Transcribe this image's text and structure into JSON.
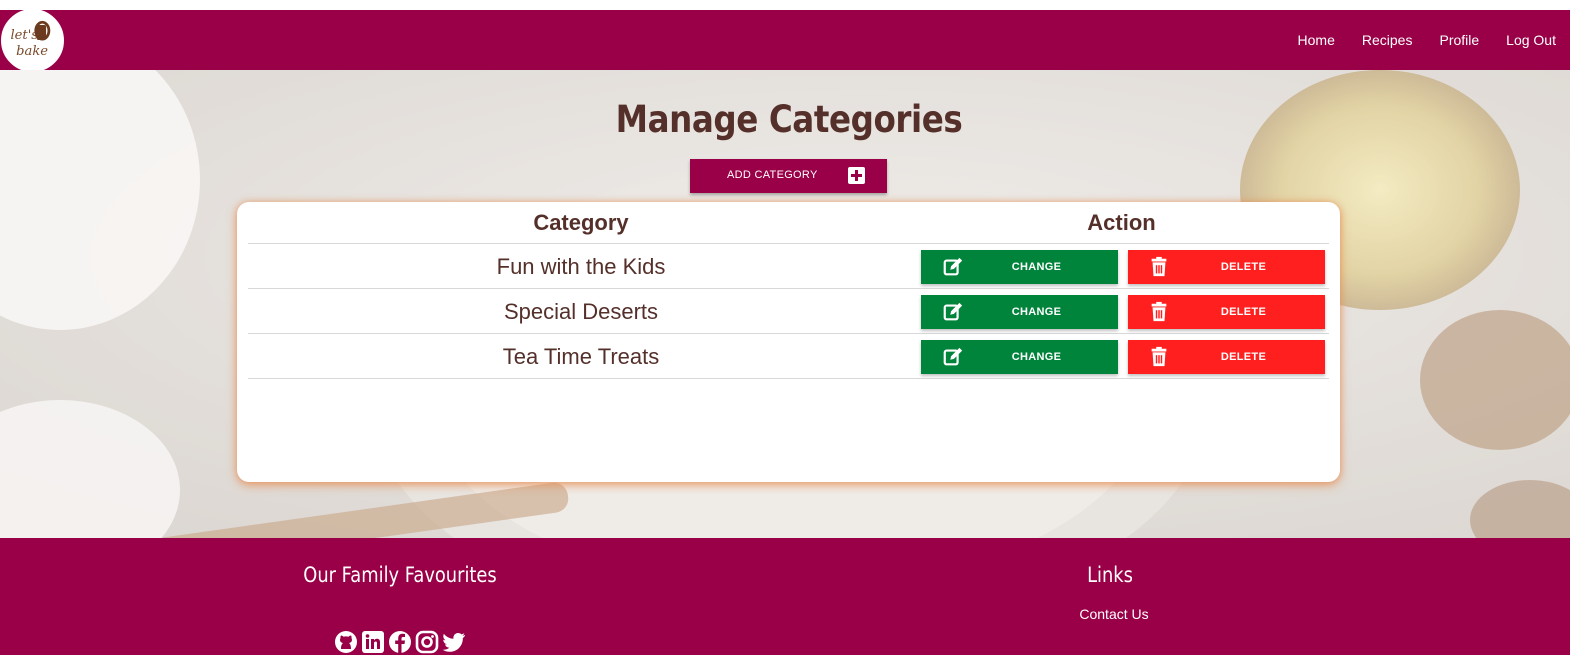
{
  "nav": {
    "logo_text": "Let's bake",
    "links": [
      "Home",
      "Recipes",
      "Profile",
      "Log Out"
    ]
  },
  "page": {
    "title": "Manage Categories",
    "add_button": "ADD CATEGORY"
  },
  "table": {
    "headers": {
      "category": "Category",
      "action": "Action"
    },
    "rows": [
      {
        "name": "Fun with the Kids",
        "change": "CHANGE",
        "delete": "DELETE"
      },
      {
        "name": "Special Deserts",
        "change": "CHANGE",
        "delete": "DELETE"
      },
      {
        "name": "Tea Time Treats",
        "change": "CHANGE",
        "delete": "DELETE"
      }
    ]
  },
  "footer": {
    "left_title": "Our Family Favourites",
    "right_title": "Links",
    "contact_link": "Contact Us",
    "social_icons": [
      "github-icon",
      "linkedin-icon",
      "facebook-icon",
      "instagram-icon",
      "twitter-icon"
    ]
  },
  "colors": {
    "brand": "#990047",
    "change": "#00833a",
    "delete": "#ff1f1f",
    "text": "#55302a"
  }
}
